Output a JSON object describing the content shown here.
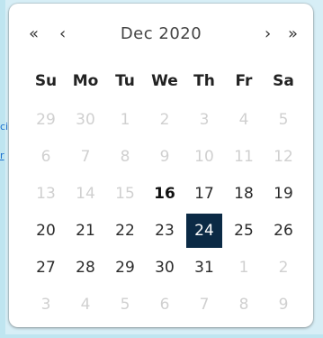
{
  "background": {
    "side_text_1": "ci",
    "side_text_2": "r"
  },
  "calendar": {
    "month_title": "Dec 2020",
    "nav": {
      "prev_year": "«",
      "prev_month": "‹",
      "next_month": "›",
      "next_year": "»"
    },
    "weekdays": [
      "Su",
      "Mo",
      "Tu",
      "We",
      "Th",
      "Fr",
      "Sa"
    ],
    "days": [
      {
        "label": "29",
        "muted": true
      },
      {
        "label": "30",
        "muted": true
      },
      {
        "label": "1",
        "muted": true
      },
      {
        "label": "2",
        "muted": true
      },
      {
        "label": "3",
        "muted": true
      },
      {
        "label": "4",
        "muted": true
      },
      {
        "label": "5",
        "muted": true
      },
      {
        "label": "6",
        "muted": true
      },
      {
        "label": "7",
        "muted": true
      },
      {
        "label": "8",
        "muted": true
      },
      {
        "label": "9",
        "muted": true
      },
      {
        "label": "10",
        "muted": true
      },
      {
        "label": "11",
        "muted": true
      },
      {
        "label": "12",
        "muted": true
      },
      {
        "label": "13",
        "muted": true
      },
      {
        "label": "14",
        "muted": true
      },
      {
        "label": "15",
        "muted": true
      },
      {
        "label": "16",
        "today": true
      },
      {
        "label": "17"
      },
      {
        "label": "18"
      },
      {
        "label": "19"
      },
      {
        "label": "20"
      },
      {
        "label": "21"
      },
      {
        "label": "22"
      },
      {
        "label": "23"
      },
      {
        "label": "24",
        "selected": true
      },
      {
        "label": "25"
      },
      {
        "label": "26"
      },
      {
        "label": "27"
      },
      {
        "label": "28"
      },
      {
        "label": "29"
      },
      {
        "label": "30"
      },
      {
        "label": "31"
      },
      {
        "label": "1",
        "muted": true
      },
      {
        "label": "2",
        "muted": true
      },
      {
        "label": "3",
        "muted": true
      },
      {
        "label": "4",
        "muted": true
      },
      {
        "label": "5",
        "muted": true
      },
      {
        "label": "6",
        "muted": true
      },
      {
        "label": "7",
        "muted": true
      },
      {
        "label": "8",
        "muted": true
      },
      {
        "label": "9",
        "muted": true
      }
    ],
    "colors": {
      "selected_bg": "#0b2a45",
      "muted_text": "#d0d0d0"
    }
  }
}
